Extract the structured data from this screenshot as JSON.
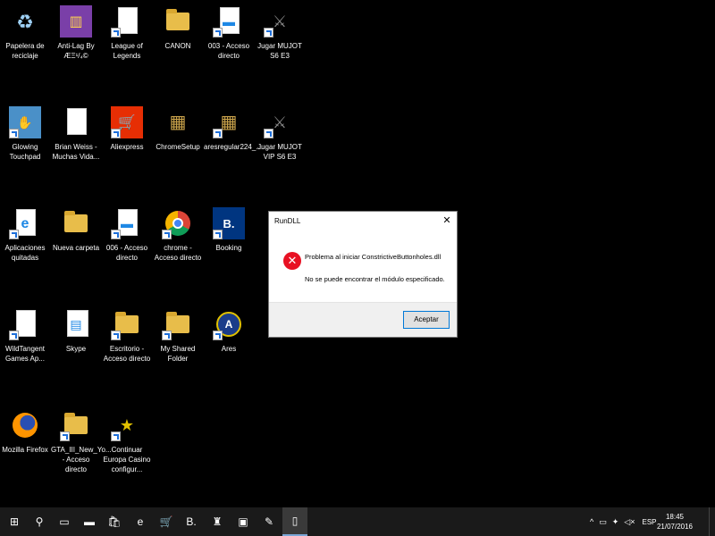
{
  "desktop_icons": [
    {
      "label": "Papelera de reciclaje",
      "icon": "recycle-bin-icon"
    },
    {
      "label": "Anti-Lag By ÆΞ¹/₄©",
      "icon": "archive-icon"
    },
    {
      "label": "League of Legends",
      "icon": "document-icon"
    },
    {
      "label": "CANON",
      "icon": "folder-icon"
    },
    {
      "label": "003 - Acceso directo",
      "icon": "video-file-icon"
    },
    {
      "label": "Jugar MUJOT S6 E3",
      "icon": "game-shield-icon"
    },
    {
      "label": "Glowing Touchpad",
      "icon": "touchpad-icon"
    },
    {
      "label": "Brian Weiss - Muchas Vida...",
      "icon": "pdf-icon"
    },
    {
      "label": "Aliexpress",
      "icon": "cart-icon"
    },
    {
      "label": "ChromeSetup",
      "icon": "installer-icon"
    },
    {
      "label": "aresregular224_...",
      "icon": "installer-box-icon"
    },
    {
      "label": "Jugar MUJOT VIP S6 E3",
      "icon": "game-shield-icon"
    },
    {
      "label": "Aplicaciones quitadas",
      "icon": "edge-icon"
    },
    {
      "label": "Nueva carpeta",
      "icon": "folder-icon"
    },
    {
      "label": "006 - Acceso directo",
      "icon": "video-file-icon"
    },
    {
      "label": "chrome - Acceso directo",
      "icon": "chrome-icon"
    },
    {
      "label": "Booking",
      "icon": "booking-icon"
    },
    {
      "label": "WildTangent Games Ap...",
      "icon": "document-icon"
    },
    {
      "label": "Skype",
      "icon": "skype-window-icon"
    },
    {
      "label": "Escritorio - Acceso directo",
      "icon": "desktop-folder-icon"
    },
    {
      "label": "My Shared Folder",
      "icon": "shared-folder-icon"
    },
    {
      "label": "Ares",
      "icon": "ares-icon"
    },
    {
      "label": "Mozilla Firefox",
      "icon": "firefox-icon"
    },
    {
      "label": "GTA_III_New_Yo... - Acceso directo",
      "icon": "game-folder-icon"
    },
    {
      "label": "Continuar Europa Casino configur...",
      "icon": "casino-icon"
    }
  ],
  "dialog": {
    "title": "RunDLL",
    "close_glyph": "✕",
    "message_line1": "Problema al iniciar ConstrictiveButtonholes.dll",
    "message_line2": "No se puede encontrar el módulo especificado.",
    "ok_label": "Aceptar",
    "error_glyph": "✕"
  },
  "taskbar": {
    "start_glyph": "⊞",
    "search_glyph": "⚲",
    "items": [
      {
        "icon": "task-view-icon",
        "glyph": "▭"
      },
      {
        "icon": "file-explorer-icon",
        "glyph": "▬"
      },
      {
        "icon": "store-icon",
        "glyph": "🛍"
      },
      {
        "icon": "edge-icon",
        "glyph": "e"
      },
      {
        "icon": "aliexpress-icon",
        "glyph": "🛒"
      },
      {
        "icon": "booking-icon",
        "glyph": "B."
      },
      {
        "icon": "game-icon",
        "glyph": "♜"
      },
      {
        "icon": "app-icon",
        "glyph": "▣"
      },
      {
        "icon": "paint-icon",
        "glyph": "✎"
      },
      {
        "icon": "notepad-icon",
        "glyph": "▯"
      }
    ],
    "tray": {
      "chevron": "^",
      "battery_glyph": "▭",
      "network_glyph": "✦",
      "volume_glyph": "◁×",
      "language": "ESP",
      "time": "18:45",
      "date": "21/07/2016"
    }
  }
}
